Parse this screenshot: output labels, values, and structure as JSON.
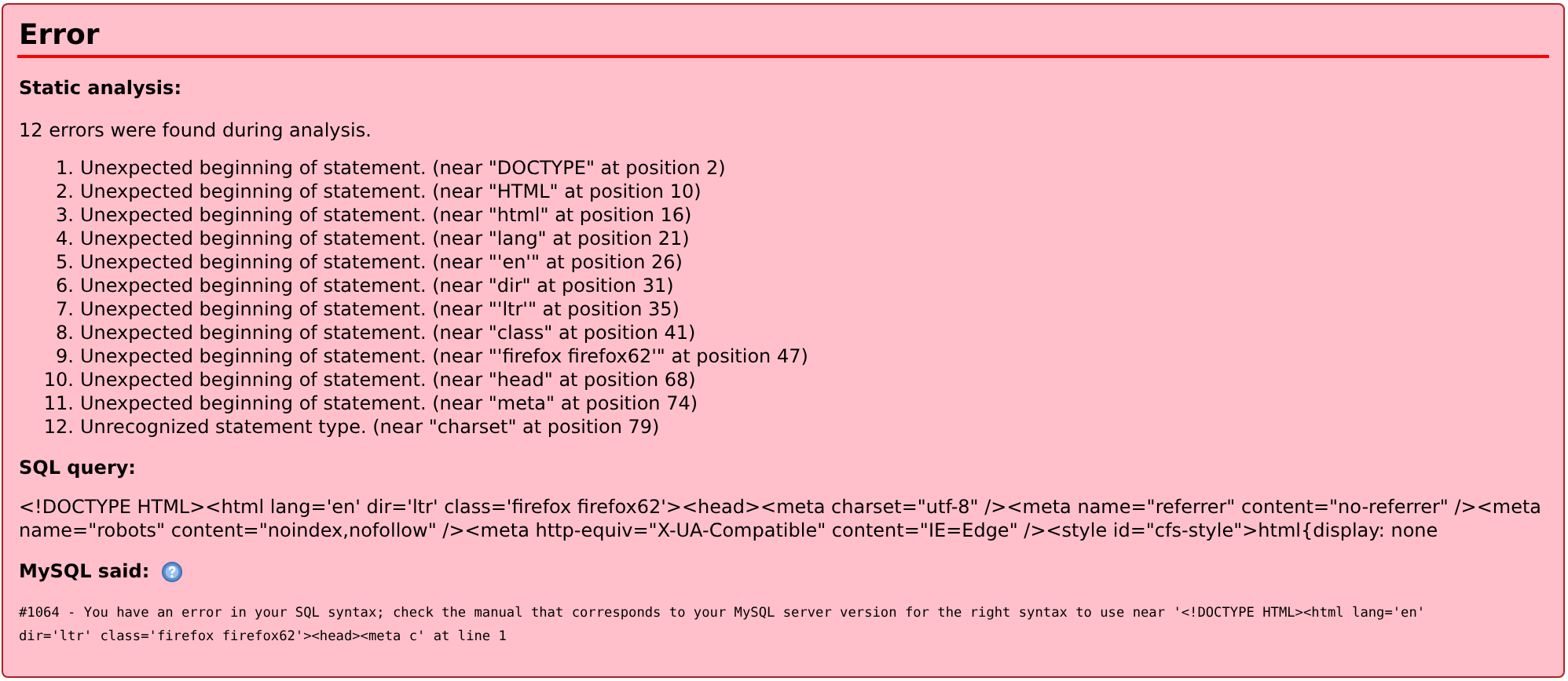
{
  "title": "Error",
  "static_analysis": {
    "heading": "Static analysis:",
    "summary": "12 errors were found during analysis.",
    "errors": [
      {
        "number": "1.",
        "text": "Unexpected beginning of statement. (near \"DOCTYPE\" at position 2)"
      },
      {
        "number": "2.",
        "text": "Unexpected beginning of statement. (near \"HTML\" at position 10)"
      },
      {
        "number": "3.",
        "text": "Unexpected beginning of statement. (near \"html\" at position 16)"
      },
      {
        "number": "4.",
        "text": "Unexpected beginning of statement. (near \"lang\" at position 21)"
      },
      {
        "number": "5.",
        "text": "Unexpected beginning of statement. (near \"'en'\" at position 26)"
      },
      {
        "number": "6.",
        "text": "Unexpected beginning of statement. (near \"dir\" at position 31)"
      },
      {
        "number": "7.",
        "text": "Unexpected beginning of statement. (near \"'ltr'\" at position 35)"
      },
      {
        "number": "8.",
        "text": "Unexpected beginning of statement. (near \"class\" at position 41)"
      },
      {
        "number": "9.",
        "text": "Unexpected beginning of statement. (near \"'firefox firefox62'\" at position 47)"
      },
      {
        "number": "10.",
        "text": "Unexpected beginning of statement. (near \"head\" at position 68)"
      },
      {
        "number": "11.",
        "text": "Unexpected beginning of statement. (near \"meta\" at position 74)"
      },
      {
        "number": "12.",
        "text": "Unrecognized statement type. (near \"charset\" at position 79)"
      }
    ]
  },
  "sql_query": {
    "heading": "SQL query:",
    "lines": [
      "<!DOCTYPE HTML><html lang='en' dir='ltr' class='firefox firefox62'><head><meta charset=\"utf-8\" /><meta name=\"referrer\" content=\"no-referrer\" /><meta",
      "name=\"robots\" content=\"noindex,nofollow\" /><meta http-equiv=\"X-UA-Compatible\" content=\"IE=Edge\" /><style id=\"cfs-style\">html{display: none"
    ]
  },
  "mysql_said": {
    "heading": "MySQL said:",
    "lines": [
      "#1064 - You have an error in your SQL syntax; check the manual that corresponds to your MySQL server version for the right syntax to use near '<!DOCTYPE HTML><html lang='en'",
      "dir='ltr' class='firefox firefox62'><head><meta c' at line 1"
    ]
  }
}
